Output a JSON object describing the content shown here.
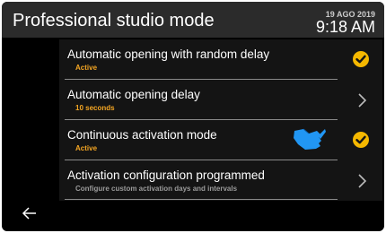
{
  "header": {
    "title": "Professional studio mode",
    "date": "19 AGO 2019",
    "time": "9:18 AM"
  },
  "items": [
    {
      "label": "Automatic opening with random delay",
      "sublabel": "Active",
      "trailing": "check-icon"
    },
    {
      "label": "Automatic opening delay",
      "sublabel": "10 seconds",
      "trailing": "chevron-right-icon"
    },
    {
      "label": "Continuous activation mode",
      "sublabel": "Active",
      "trailing": "check-icon"
    },
    {
      "label": "Activation configuration programmed",
      "sublabel": "Configure custom activation days and intervals",
      "trailing": "chevron-right-icon"
    }
  ],
  "footer": {
    "back_icon": "arrow-left-icon"
  },
  "overlay": {
    "icon": "pointing-hand-icon"
  },
  "colors": {
    "accent": "#f5b800",
    "sublabel_active": "#f5a623",
    "sublabel_info": "#9a9a9a",
    "hand": "#2196f3",
    "topbar": "#2b2b2b"
  }
}
